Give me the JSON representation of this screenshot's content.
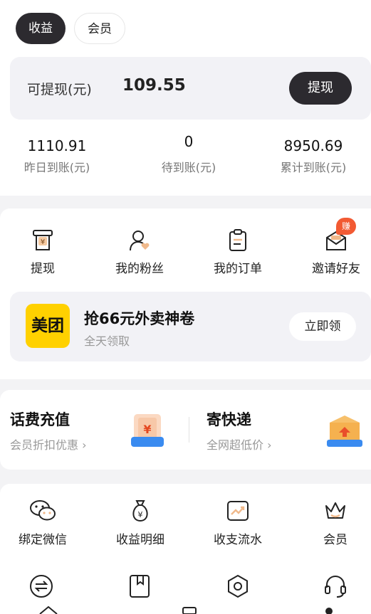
{
  "tabs": [
    {
      "label": "收益",
      "active": true
    },
    {
      "label": "会员",
      "active": false
    }
  ],
  "withdraw": {
    "label": "可提现(元)",
    "amount": "109.55",
    "button": "提现"
  },
  "stats": [
    {
      "value": "1110.91",
      "label": "昨日到账(元)"
    },
    {
      "value": "0",
      "label": "待到账(元)"
    },
    {
      "value": "8950.69",
      "label": "累计到账(元)"
    }
  ],
  "quick_actions": [
    {
      "label": "提现",
      "icon": "atm-yen-icon"
    },
    {
      "label": "我的粉丝",
      "icon": "user-heart-icon"
    },
    {
      "label": "我的订单",
      "icon": "clipboard-icon"
    },
    {
      "label": "邀请好友",
      "icon": "envelope-icon",
      "badge": "赚"
    }
  ],
  "promo": {
    "logo_text": "美团",
    "title": "抢66元外卖神卷",
    "subtitle": "全天领取",
    "button": "立即领"
  },
  "services": [
    {
      "title": "话费充值",
      "subtitle": "会员折扣优惠",
      "icon": "phone-recharge-icon"
    },
    {
      "title": "寄快递",
      "subtitle": "全网超低价",
      "icon": "parcel-box-icon"
    }
  ],
  "grid": [
    {
      "label": "绑定微信",
      "icon": "wechat-icon"
    },
    {
      "label": "收益明细",
      "icon": "money-bag-icon"
    },
    {
      "label": "收支流水",
      "icon": "trend-chart-icon"
    },
    {
      "label": "会员",
      "icon": "crown-icon"
    }
  ],
  "grid_row2_icons": [
    "exchange-icon",
    "bookmark-icon",
    "hexagon-settings-icon",
    "headset-icon"
  ],
  "colors": {
    "dark": "#2c2a2f",
    "meituan_yellow": "#ffd100",
    "badge_orange": "#f25a33",
    "page_bg": "#f3f3f5"
  }
}
